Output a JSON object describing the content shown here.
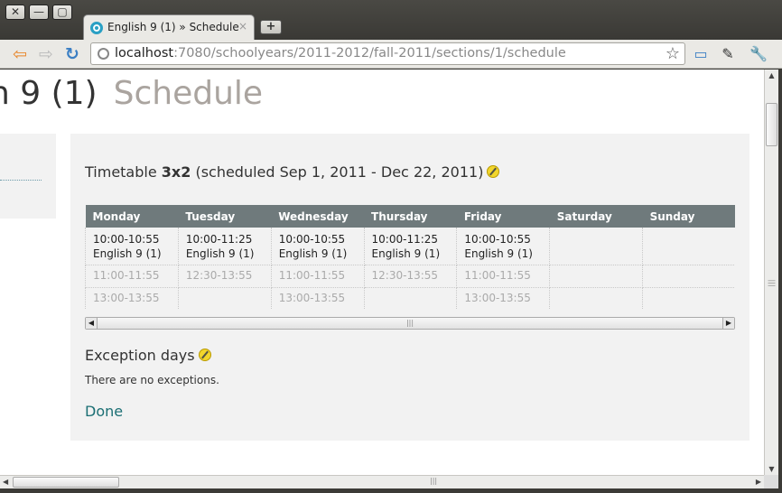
{
  "window": {
    "close_icon": "✕",
    "minimize_icon": "—",
    "maximize_icon": "▢"
  },
  "tab": {
    "title": "English 9 (1) » Schedule",
    "close": "×",
    "new_tab": "+"
  },
  "toolbar": {
    "back": "⇦",
    "forward": "⇨",
    "reload": "↻",
    "url_host": "localhost",
    "url_path": ":7080/schoolyears/2011-2012/fall-2011/sections/1/schedule",
    "bookmark": "☆",
    "fullscreen": "▭",
    "pin": "✎",
    "wrench": "🔧"
  },
  "page": {
    "title_main": "h 9 (1)",
    "title_sub": "Schedule"
  },
  "timetable": {
    "heading_prefix": "Timetable ",
    "name": "3x2",
    "heading_suffix": " (scheduled Sep 1, 2011 - Dec 22, 2011)",
    "days": [
      "Monday",
      "Tuesday",
      "Wednesday",
      "Thursday",
      "Friday",
      "Saturday",
      "Sunday"
    ],
    "rows": [
      {
        "cells": [
          {
            "time": "10:00-10:55",
            "course": "English 9 (1)"
          },
          {
            "time": "10:00-11:25",
            "course": "English 9 (1)"
          },
          {
            "time": "10:00-10:55",
            "course": "English 9 (1)"
          },
          {
            "time": "10:00-11:25",
            "course": "English 9 (1)"
          },
          {
            "time": "10:00-10:55",
            "course": "English 9 (1)"
          },
          {
            "time": "",
            "course": ""
          },
          {
            "time": "",
            "course": ""
          }
        ]
      },
      {
        "cells": [
          "11:00-11:55",
          "12:30-13:55",
          "11:00-11:55",
          "12:30-13:55",
          "11:00-11:55",
          "",
          ""
        ]
      },
      {
        "cells": [
          "13:00-13:55",
          "",
          "13:00-13:55",
          "",
          "13:00-13:55",
          "",
          ""
        ]
      }
    ]
  },
  "exceptions": {
    "heading": "Exception days",
    "text": "There are no exceptions."
  },
  "done_label": "Done",
  "scroll": {
    "grip": "|||",
    "left": "◀",
    "right": "▶",
    "up": "▲",
    "down": "▼"
  }
}
